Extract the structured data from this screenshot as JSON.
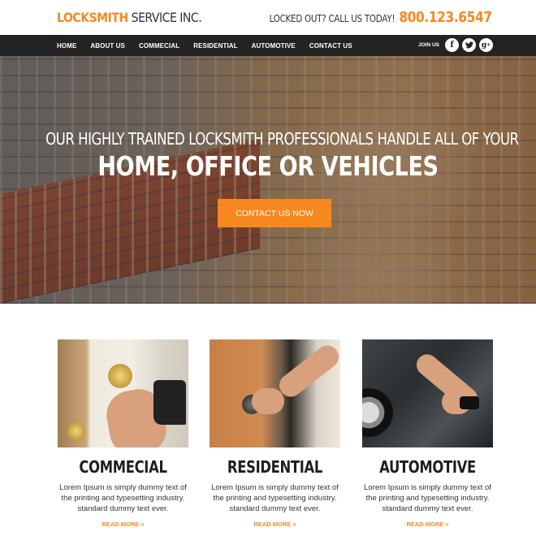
{
  "header": {
    "logo_accent": "LOCKSMITH",
    "logo_rest": " SERVICE INC.",
    "callout_text": "LOCKED OUT? CALL US TODAY!",
    "phone": "800.123.6547"
  },
  "nav": {
    "items": [
      {
        "label": "HOME"
      },
      {
        "label": "ABOUT US"
      },
      {
        "label": "COMMECIAL"
      },
      {
        "label": "RESIDENTIAL"
      },
      {
        "label": "AUTOMOTIVE"
      },
      {
        "label": "CONTACT US"
      }
    ],
    "join_label": "JOIN US",
    "social": [
      {
        "name": "facebook-icon",
        "glyph": "f"
      },
      {
        "name": "twitter-icon",
        "glyph": "t"
      },
      {
        "name": "google-plus-icon",
        "glyph": "g+"
      }
    ]
  },
  "hero": {
    "subtitle": "OUR HIGHLY TRAINED LOCKSMITH PROFESSIONALS HANDLE ALL OF YOUR",
    "title": "HOME, OFFICE OR VEHICLES",
    "cta_label": "CONTACT US NOW"
  },
  "services": [
    {
      "title": "COMMECIAL",
      "body": "Lorem Ipsum is simply dummy text of the printing and typesetting industry. standard dummy text ever.",
      "link": "READ MORE »",
      "image": "locksmith-picking-deadbolt"
    },
    {
      "title": "RESIDENTIAL",
      "body": "Lorem Ipsum is simply dummy text of the printing and typesetting industry. standard dummy text ever.",
      "link": "READ MORE »",
      "image": "hand-turning-door-knob"
    },
    {
      "title": "AUTOMOTIVE",
      "body": "Lorem Ipsum is simply dummy text of the printing and typesetting industry. standard dummy text ever.",
      "link": "READ MORE »",
      "image": "hand-on-car-door-handle"
    }
  ],
  "colors": {
    "accent": "#f7881f",
    "nav_bg": "#232323",
    "text_dark": "#1f1f1f"
  }
}
